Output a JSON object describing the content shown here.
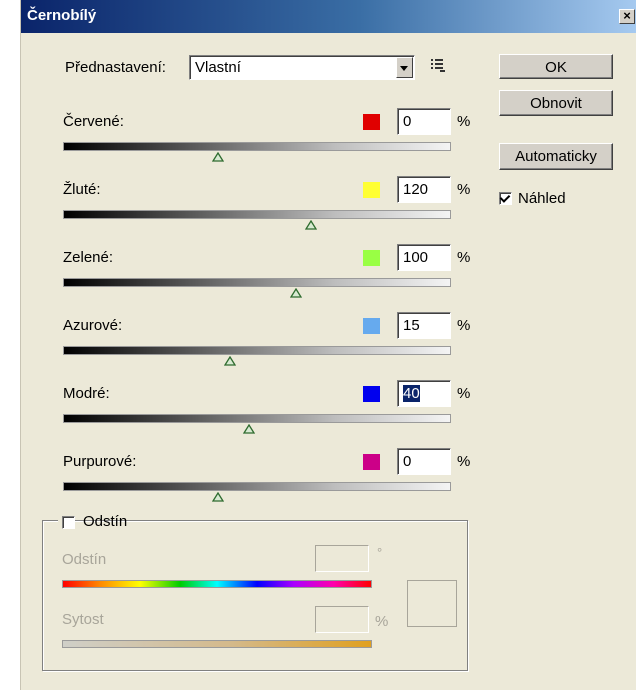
{
  "window": {
    "title": "Černobílý",
    "close_label": "×"
  },
  "preset": {
    "label": "Přednastavení:",
    "value": "Vlastní"
  },
  "buttons": {
    "ok": "OK",
    "reset": "Obnovit",
    "auto": "Automaticky"
  },
  "preview": {
    "label": "Náhled",
    "checked": true
  },
  "channels": [
    {
      "label": "Červené:",
      "value": "0",
      "color": "#e00000",
      "slider": 0.4,
      "unit": "%"
    },
    {
      "label": "Žluté:",
      "value": "120",
      "color": "#ffff33",
      "slider": 0.64,
      "unit": "%"
    },
    {
      "label": "Zelené:",
      "value": "100",
      "color": "#99ff44",
      "slider": 0.6,
      "unit": "%"
    },
    {
      "label": "Azurové:",
      "value": "15",
      "color": "#66aaee",
      "slider": 0.43,
      "unit": "%"
    },
    {
      "label": "Modré:",
      "value": "40",
      "color": "#0000ee",
      "slider": 0.48,
      "unit": "%",
      "selected": true
    },
    {
      "label": "Purpurové:",
      "value": "0",
      "color": "#cc0088",
      "slider": 0.4,
      "unit": "%"
    }
  ],
  "tint": {
    "checkbox_label": "Odstín",
    "checked": false,
    "hue_label": "Odstín",
    "hue_unit": "°",
    "saturation_label": "Sytost",
    "saturation_unit": "%"
  }
}
